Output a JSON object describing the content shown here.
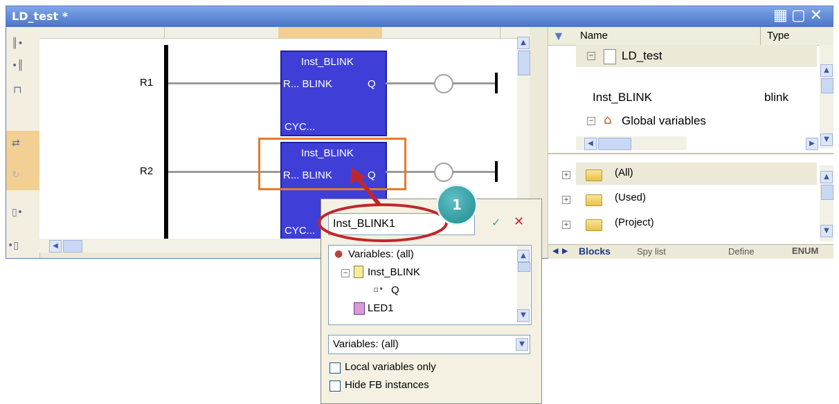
{
  "window": {
    "title": "LD_test *",
    "title_buttons": [
      "tile-icon",
      "maximize-icon",
      "close-icon"
    ]
  },
  "left_toolbar": {
    "icons": [
      "contact-icon",
      "parallel-contact-icon",
      "branch-icon",
      "line-icon",
      "cycle-icon",
      "coil-icon",
      "parallel-coil-icon"
    ]
  },
  "editor": {
    "rungs": [
      {
        "label": "R1",
        "block": {
          "name": "Inst_BLINK",
          "input_label": "R... BLINK",
          "output_label": "Q",
          "cycle_label": "CYC..."
        }
      },
      {
        "label": "R2",
        "block": {
          "name": "Inst_BLINK",
          "input_label": "R... BLINK",
          "output_label": "Q",
          "cycle_label": "CYC..."
        }
      }
    ]
  },
  "right_panel": {
    "columns": {
      "name": "Name",
      "type": "Type"
    },
    "tree": [
      {
        "name": "LD_test",
        "type": ""
      },
      {
        "name": "Inst_BLINK",
        "type": "blink"
      },
      {
        "name": "Global variables",
        "type": ""
      }
    ],
    "folders": [
      "(All)",
      "(Used)",
      "(Project)"
    ],
    "tabs": [
      "Blocks",
      "Spy list",
      "Define",
      "ENUM"
    ]
  },
  "popup": {
    "input_value": "Inst_BLINK1",
    "tree": [
      {
        "label": "Variables: (all)"
      },
      {
        "label": "Inst_BLINK"
      },
      {
        "label": "Q"
      },
      {
        "label": "LED1"
      }
    ],
    "filter_value": "Variables: (all)",
    "checkboxes": [
      {
        "label": "Local variables only",
        "checked": false
      },
      {
        "label": "Hide FB instances",
        "checked": false
      }
    ]
  },
  "callout": {
    "number": "1"
  },
  "colors": {
    "title_bar": "#4b74c8",
    "block_fill": "#3f3fd8",
    "highlight": "#e67a2a",
    "annotation": "#c0262c",
    "badge": "#2a9aa0"
  }
}
